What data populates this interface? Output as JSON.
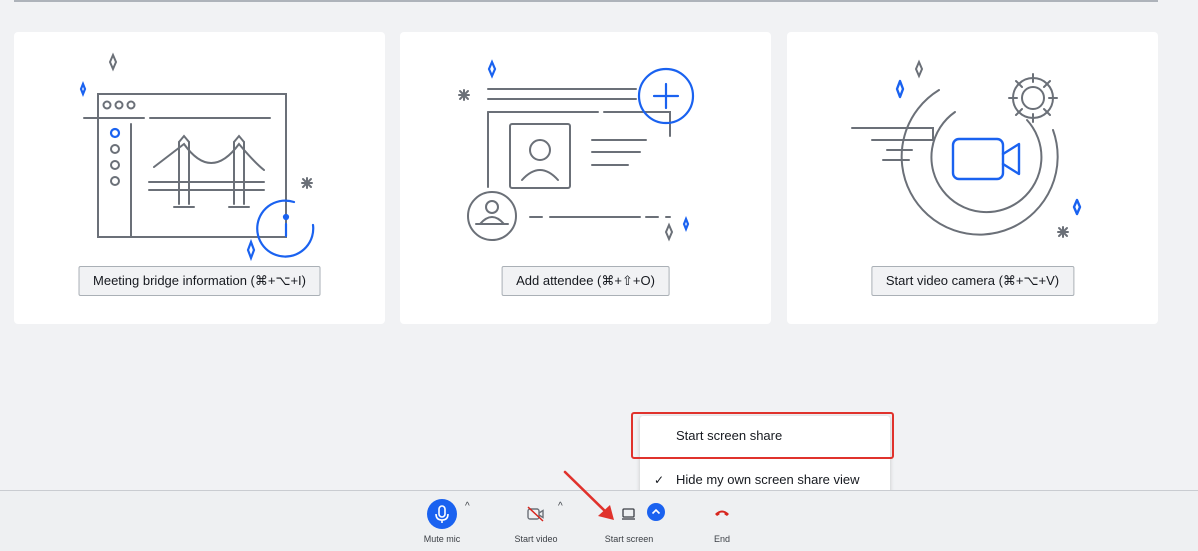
{
  "cards": [
    {
      "button_label": "Meeting bridge information (⌘+⌥+I)",
      "illustration": "bridge-browser-info-icon"
    },
    {
      "button_label": "Add attendee (⌘+⇧+O)",
      "illustration": "contact-card-add-icon"
    },
    {
      "button_label": "Start video camera (⌘+⌥+V)",
      "illustration": "video-camera-gear-icon"
    }
  ],
  "share_menu": {
    "items": [
      {
        "label": "Start screen share",
        "checked": false
      },
      {
        "label": "Hide my own screen share view",
        "checked": true
      }
    ]
  },
  "toolbar": {
    "mute_label": "Mute mic",
    "video_label": "Start video",
    "screen_label": "Start screen",
    "end_label": "End"
  },
  "icons": {
    "mic": "microphone-icon",
    "video": "video-off-icon",
    "screen": "screen-share-icon",
    "end": "phone-hangup-icon",
    "caret": "chevron-up-icon",
    "check": "checkmark-icon"
  },
  "colors": {
    "accent": "#1a62f0",
    "line_gray": "#6b7078",
    "end_red": "#d7261e",
    "annotation_red": "#e0322c"
  }
}
